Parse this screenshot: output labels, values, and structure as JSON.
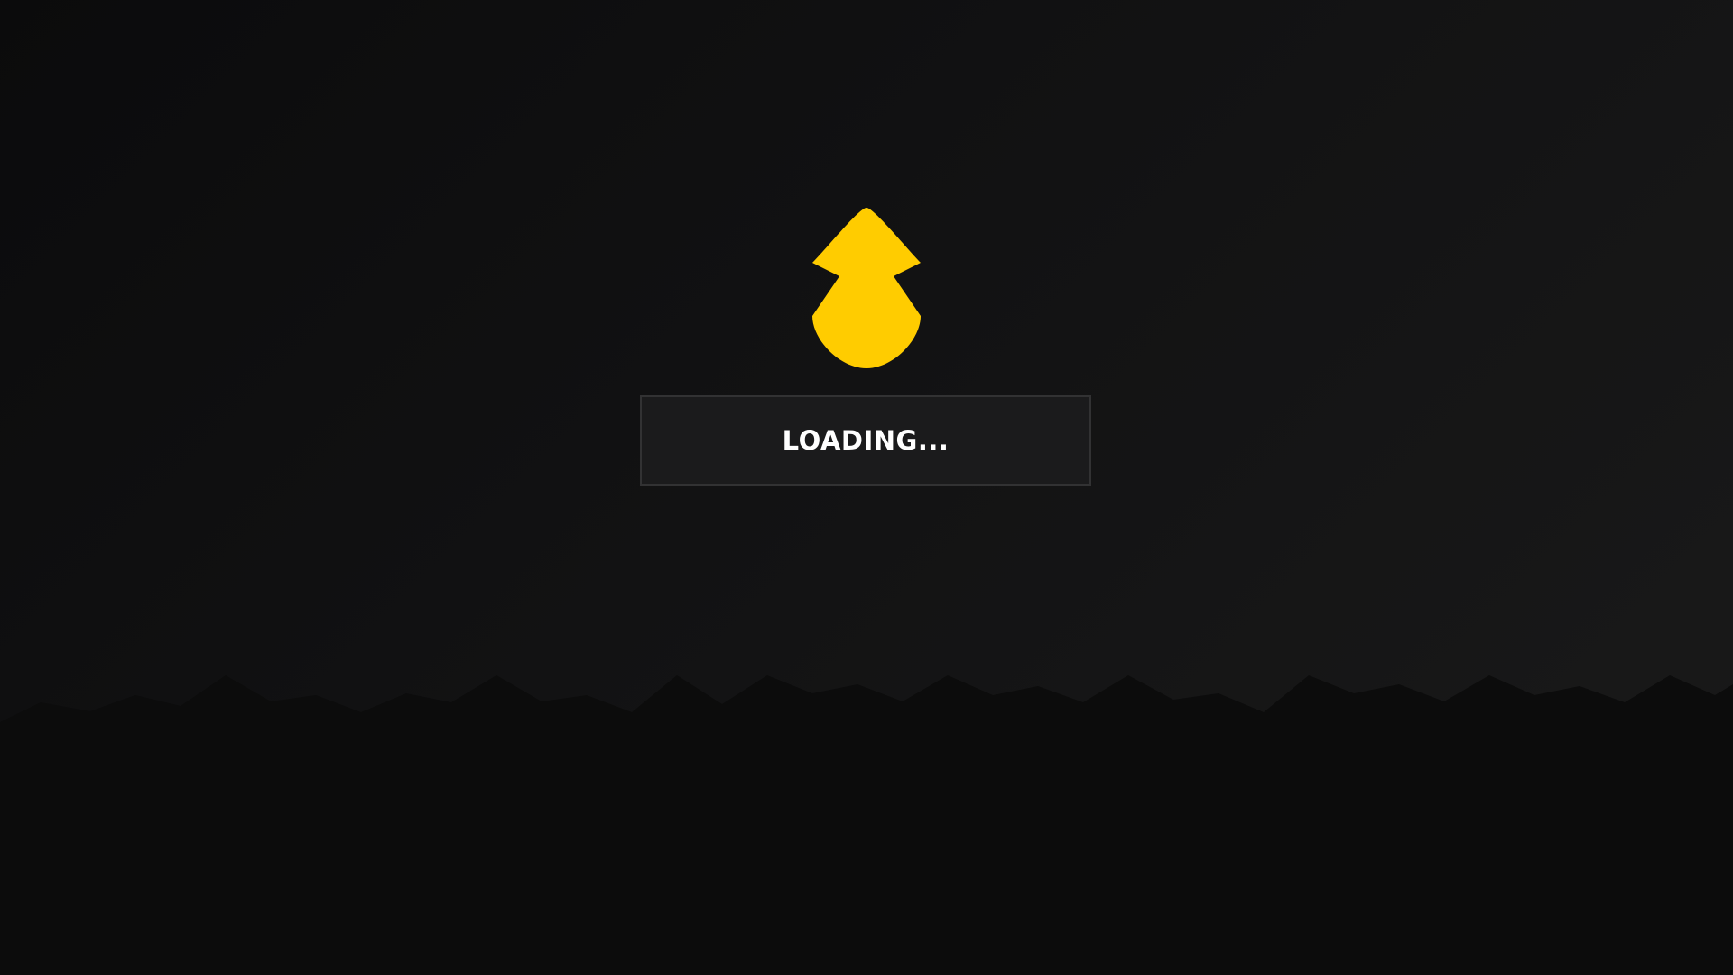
{
  "loading": {
    "label": "LOADING..."
  },
  "logo": {
    "icon": "squid-logo-icon",
    "color": "#FFCC00"
  },
  "colors": {
    "background_top": "#0b0b0c",
    "background_bottom": "#0c0c0c",
    "panel_fill": "#1b1b1c",
    "panel_border": "#323233",
    "text": "#ffffff"
  }
}
